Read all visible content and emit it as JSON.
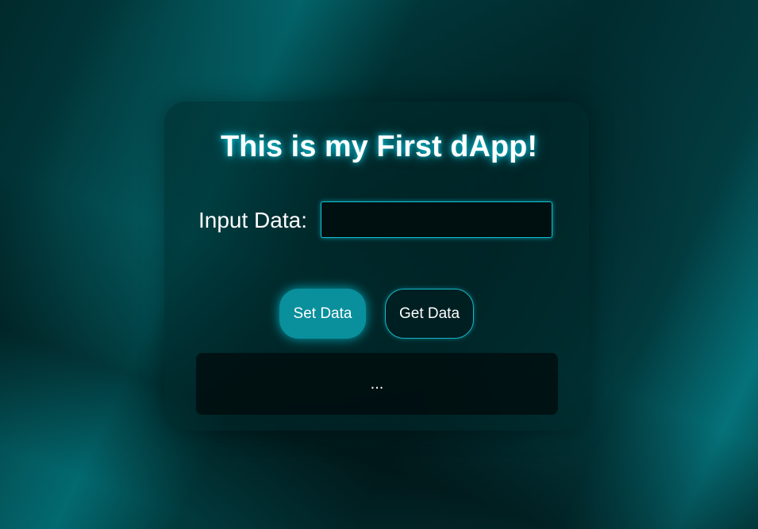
{
  "app": {
    "title": "This is my First dApp!"
  },
  "form": {
    "input_label": "Input Data:",
    "input_value": "",
    "input_placeholder": ""
  },
  "buttons": {
    "set_label": "Set Data",
    "get_label": "Get Data"
  },
  "output": {
    "text": "..."
  },
  "colors": {
    "accent": "#0a8f9c",
    "glow": "#12c0d0",
    "background": "#013437"
  }
}
